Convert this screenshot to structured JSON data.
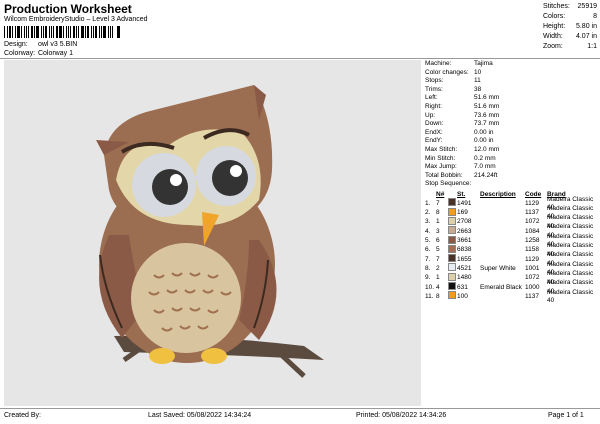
{
  "header": {
    "title": "Production Worksheet",
    "subtitle": "Wilcom EmbroideryStudio – Level 3 Advanced",
    "design_label": "Design:",
    "design_value": "owl v3 5.BIN",
    "colorway_label": "Colorway:",
    "colorway_value": "Colorway 1"
  },
  "summary": [
    {
      "label": "Stitches:",
      "value": "25919"
    },
    {
      "label": "Colors:",
      "value": "8"
    },
    {
      "label": "Height:",
      "value": "5.80 in"
    },
    {
      "label": "Width:",
      "value": "4.07 in"
    },
    {
      "label": "Zoom:",
      "value": "1:1"
    }
  ],
  "details": [
    {
      "label": "Machine:",
      "value": "Tajima"
    },
    {
      "label": "Color changes:",
      "value": "10"
    },
    {
      "label": "Stops:",
      "value": "11"
    },
    {
      "label": "Trims:",
      "value": "38"
    },
    {
      "label": "Left:",
      "value": "51.6 mm"
    },
    {
      "label": "Right:",
      "value": "51.6 mm"
    },
    {
      "label": "Up:",
      "value": "73.6 mm"
    },
    {
      "label": "Down:",
      "value": "73.7 mm"
    },
    {
      "label": "EndX:",
      "value": "0.00 in"
    },
    {
      "label": "EndY:",
      "value": "0.00 in"
    },
    {
      "label": "Max Stitch:",
      "value": "12.0 mm"
    },
    {
      "label": "Min Stitch:",
      "value": "0.2 mm"
    },
    {
      "label": "Max Jump:",
      "value": "7.0 mm"
    },
    {
      "label": "Total Bobbin:",
      "value": "214.24ft"
    }
  ],
  "stop_sequence": {
    "title": "Stop Sequence:",
    "headers": [
      "N#",
      "St.",
      "Description",
      "Code",
      "Brand"
    ],
    "rows": [
      {
        "num": "1.",
        "n": "7",
        "color": "#4a3326",
        "st": "1491",
        "desc": "",
        "code": "1129",
        "brand": "Madeira Classic 40"
      },
      {
        "num": "2.",
        "n": "8",
        "color": "#f19c1e",
        "st": "169",
        "desc": "",
        "code": "1137",
        "brand": "Madeira Classic 40"
      },
      {
        "num": "3.",
        "n": "1",
        "color": "#ddd1ad",
        "st": "2708",
        "desc": "",
        "code": "1072",
        "brand": "Madeira Classic 40"
      },
      {
        "num": "4.",
        "n": "3",
        "color": "#c8a992",
        "st": "2663",
        "desc": "",
        "code": "1084",
        "brand": "Madeira Classic 40"
      },
      {
        "num": "5.",
        "n": "6",
        "color": "#8a5a47",
        "st": "3661",
        "desc": "",
        "code": "1258",
        "brand": "Madeira Classic 40"
      },
      {
        "num": "6.",
        "n": "5",
        "color": "#a46e54",
        "st": "6838",
        "desc": "",
        "code": "1158",
        "brand": "Madeira Classic 40"
      },
      {
        "num": "7.",
        "n": "7",
        "color": "#4a3326",
        "st": "1655",
        "desc": "",
        "code": "1129",
        "brand": "Madeira Classic 40"
      },
      {
        "num": "8.",
        "n": "2",
        "color": "#e8ecf4",
        "st": "4521",
        "desc": "Super White",
        "code": "1001",
        "brand": "Madeira Classic 40"
      },
      {
        "num": "9.",
        "n": "1",
        "color": "#ddd1ad",
        "st": "1480",
        "desc": "",
        "code": "1072",
        "brand": "Madeira Classic 40"
      },
      {
        "num": "10.",
        "n": "4",
        "color": "#111111",
        "st": "631",
        "desc": "Emerald Black",
        "code": "1000",
        "brand": "Madeira Classic 40"
      },
      {
        "num": "11.",
        "n": "8",
        "color": "#f19c1e",
        "st": "100",
        "desc": "",
        "code": "1137",
        "brand": "Madeira Classic 40"
      }
    ]
  },
  "footer": {
    "created_by": "Created By:",
    "last_saved": "Last Saved: 05/08/2022 14:34:24",
    "printed": "Printed: 05/08/2022 14:34:26",
    "page": "Page 1 of 1"
  }
}
